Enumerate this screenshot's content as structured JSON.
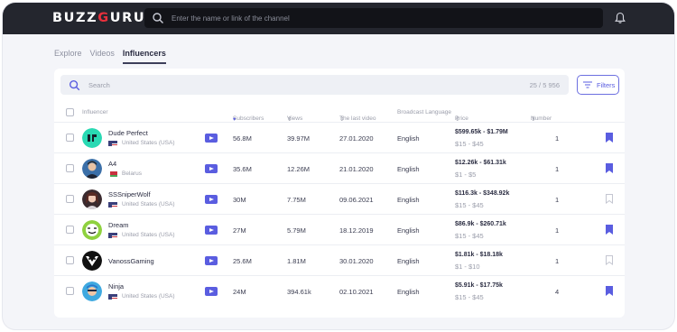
{
  "app": {
    "logo_left": "BUZZ",
    "logo_accent": "G",
    "logo_right": "URU",
    "top_search_placeholder": "Enter the name or link of the channel"
  },
  "tabs": [
    {
      "label": "Explore",
      "active": false
    },
    {
      "label": "Videos",
      "active": false
    },
    {
      "label": "Influencers",
      "active": true
    }
  ],
  "search": {
    "placeholder": "Search",
    "count": "25 / 5 956",
    "filters_label": "Filters"
  },
  "columns": {
    "influencer": "Influencer",
    "subscribers": "Subscribers",
    "views": "Views",
    "last_video": "The last video",
    "language": "Broadcast Language",
    "price": "Price",
    "number": "Number"
  },
  "rows": [
    {
      "name": "Dude Perfect",
      "country": "United States (USA)",
      "subscribers": "56.8M",
      "views": "39.97M",
      "last_video": "27.01.2020",
      "language": "English",
      "price": "$599.65k - $1.79M",
      "price_sub": "$15 - $45",
      "number": "1",
      "bookmarked": true
    },
    {
      "name": "A4",
      "country": "Belarus",
      "subscribers": "35.6M",
      "views": "12.26M",
      "last_video": "21.01.2020",
      "language": "English",
      "price": "$12.26k - $61.31k",
      "price_sub": "$1 - $5",
      "number": "1",
      "bookmarked": true
    },
    {
      "name": "SSSniperWolf",
      "country": "United States (USA)",
      "subscribers": "30M",
      "views": "7.75M",
      "last_video": "09.06.2021",
      "language": "English",
      "price": "$116.3k - $348.92k",
      "price_sub": "$15 - $45",
      "number": "1",
      "bookmarked": false
    },
    {
      "name": "Dream",
      "country": "United States (USA)",
      "subscribers": "27M",
      "views": "5.79M",
      "last_video": "18.12.2019",
      "language": "English",
      "price": "$86.9k - $260.71k",
      "price_sub": "$15 - $45",
      "number": "1",
      "bookmarked": true
    },
    {
      "name": "VanossGaming",
      "country": "",
      "subscribers": "25.6M",
      "views": "1.81M",
      "last_video": "30.01.2020",
      "language": "English",
      "price": "$1.81k - $18.18k",
      "price_sub": "$1 - $10",
      "number": "1",
      "bookmarked": false
    },
    {
      "name": "Ninja",
      "country": "United States (USA)",
      "subscribers": "24M",
      "views": "394.61k",
      "last_video": "02.10.2021",
      "language": "English",
      "price": "$5.91k - $17.75k",
      "price_sub": "$15 - $45",
      "number": "4",
      "bookmarked": true
    }
  ],
  "colors": {
    "accent": "#5a5de0",
    "logo_red": "#e9303c",
    "topbar": "#24262e"
  }
}
